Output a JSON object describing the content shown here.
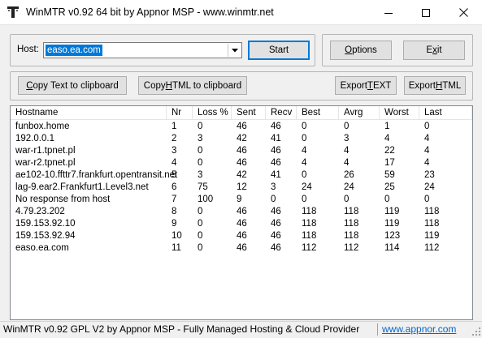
{
  "window": {
    "title": "WinMTR v0.92 64 bit by Appnor MSP - www.winmtr.net",
    "controls": [
      "minimize-icon",
      "maximize-icon",
      "close-icon"
    ]
  },
  "host": {
    "label": "Host:",
    "value": "easo.ea.com"
  },
  "buttons": {
    "start": "Start",
    "options_pre": "",
    "options_key": "O",
    "options_post": "ptions",
    "exit_pre": "E",
    "exit_key": "x",
    "exit_post": "it",
    "copy_text_pre": "",
    "copy_text_key": "C",
    "copy_text_post": "opy Text to clipboard",
    "copy_html_pre": "Copy ",
    "copy_html_key": "H",
    "copy_html_post": "TML to clipboard",
    "export_text_pre": "Export ",
    "export_text_key": "T",
    "export_text_post": "EXT",
    "export_html_pre": "Export ",
    "export_html_key": "H",
    "export_html_post": "TML"
  },
  "table": {
    "columns": [
      "Hostname",
      "Nr",
      "Loss %",
      "Sent",
      "Recv",
      "Best",
      "Avrg",
      "Worst",
      "Last"
    ],
    "rows": [
      [
        "funbox.home",
        "1",
        "0",
        "46",
        "46",
        "0",
        "0",
        "1",
        "0"
      ],
      [
        "192.0.0.1",
        "2",
        "3",
        "42",
        "41",
        "0",
        "3",
        "4",
        "4"
      ],
      [
        "war-r1.tpnet.pl",
        "3",
        "0",
        "46",
        "46",
        "4",
        "4",
        "22",
        "4"
      ],
      [
        "war-r2.tpnet.pl",
        "4",
        "0",
        "46",
        "46",
        "4",
        "4",
        "17",
        "4"
      ],
      [
        "ae102-10.ffttr7.frankfurt.opentransit.net",
        "5",
        "3",
        "42",
        "41",
        "0",
        "26",
        "59",
        "23"
      ],
      [
        "lag-9.ear2.Frankfurt1.Level3.net",
        "6",
        "75",
        "12",
        "3",
        "24",
        "24",
        "25",
        "24"
      ],
      [
        "No response from host",
        "7",
        "100",
        "9",
        "0",
        "0",
        "0",
        "0",
        "0"
      ],
      [
        "4.79.23.202",
        "8",
        "0",
        "46",
        "46",
        "118",
        "118",
        "119",
        "118"
      ],
      [
        "159.153.92.10",
        "9",
        "0",
        "46",
        "46",
        "118",
        "118",
        "119",
        "118"
      ],
      [
        "159.153.92.94",
        "10",
        "0",
        "46",
        "46",
        "118",
        "118",
        "123",
        "119"
      ],
      [
        "easo.ea.com",
        "11",
        "0",
        "46",
        "46",
        "112",
        "112",
        "114",
        "112"
      ]
    ]
  },
  "status": {
    "text": "WinMTR v0.92 GPL V2 by Appnor MSP - Fully Managed Hosting & Cloud Provider",
    "link": "www.appnor.com"
  },
  "colors": {
    "selection": "#0078d7",
    "link": "#0066cc",
    "focus_border": "#0078d7"
  }
}
